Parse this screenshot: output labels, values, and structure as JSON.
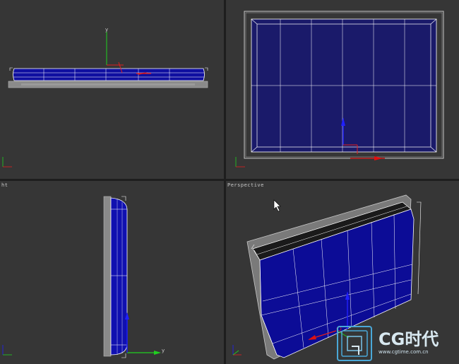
{
  "viewports": {
    "top_left": {
      "label": ""
    },
    "top_right": {
      "label": ""
    },
    "bottom_left": {
      "label": "ht"
    },
    "bottom_right": {
      "label": "Perspective"
    }
  },
  "axis_labels": {
    "x": "x",
    "y": "y",
    "z": "z"
  },
  "watermark": {
    "brand": "CG时代",
    "url": "www.cgtime.com.cn"
  },
  "colors": {
    "viewport_bg": "#363636",
    "mesh_blue": "#0a0a8a",
    "mesh_blue_light": "#1414b8",
    "frame_gray": "#8c8c8c",
    "wire_white": "#ffffff",
    "axis_x": "#e01010",
    "axis_y": "#10c010",
    "axis_z": "#1010e0"
  }
}
